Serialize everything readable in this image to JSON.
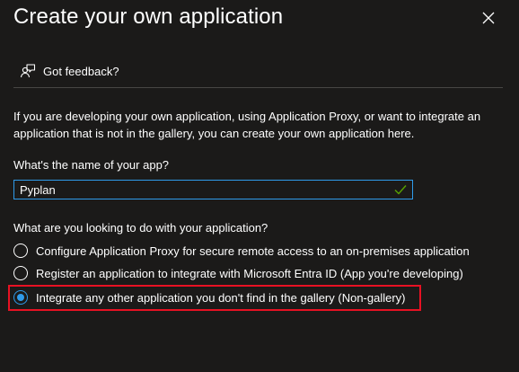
{
  "panel": {
    "title": "Create your own application",
    "close_icon": "close-icon"
  },
  "feedback": {
    "icon": "feedback-person-icon",
    "label": "Got feedback?"
  },
  "intro_text": "If you are developing your own application, using Application Proxy, or want to integrate an application that is not in the gallery, you can create your own application here.",
  "name_field": {
    "label": "What's the name of your app?",
    "value": "Pyplan",
    "valid_icon": "checkmark-icon"
  },
  "purpose": {
    "question": "What are you looking to do with your application?",
    "options": [
      {
        "label": "Configure Application Proxy for secure remote access to an on-premises application",
        "selected": false
      },
      {
        "label": "Register an application to integrate with Microsoft Entra ID (App you're developing)",
        "selected": false
      },
      {
        "label": "Integrate any other application you don't find in the gallery (Non-gallery)",
        "selected": true
      }
    ]
  },
  "colors": {
    "background": "#1b1a19",
    "accent": "#2f9bea",
    "highlight": "#e81123",
    "valid_check": "#57a300"
  }
}
